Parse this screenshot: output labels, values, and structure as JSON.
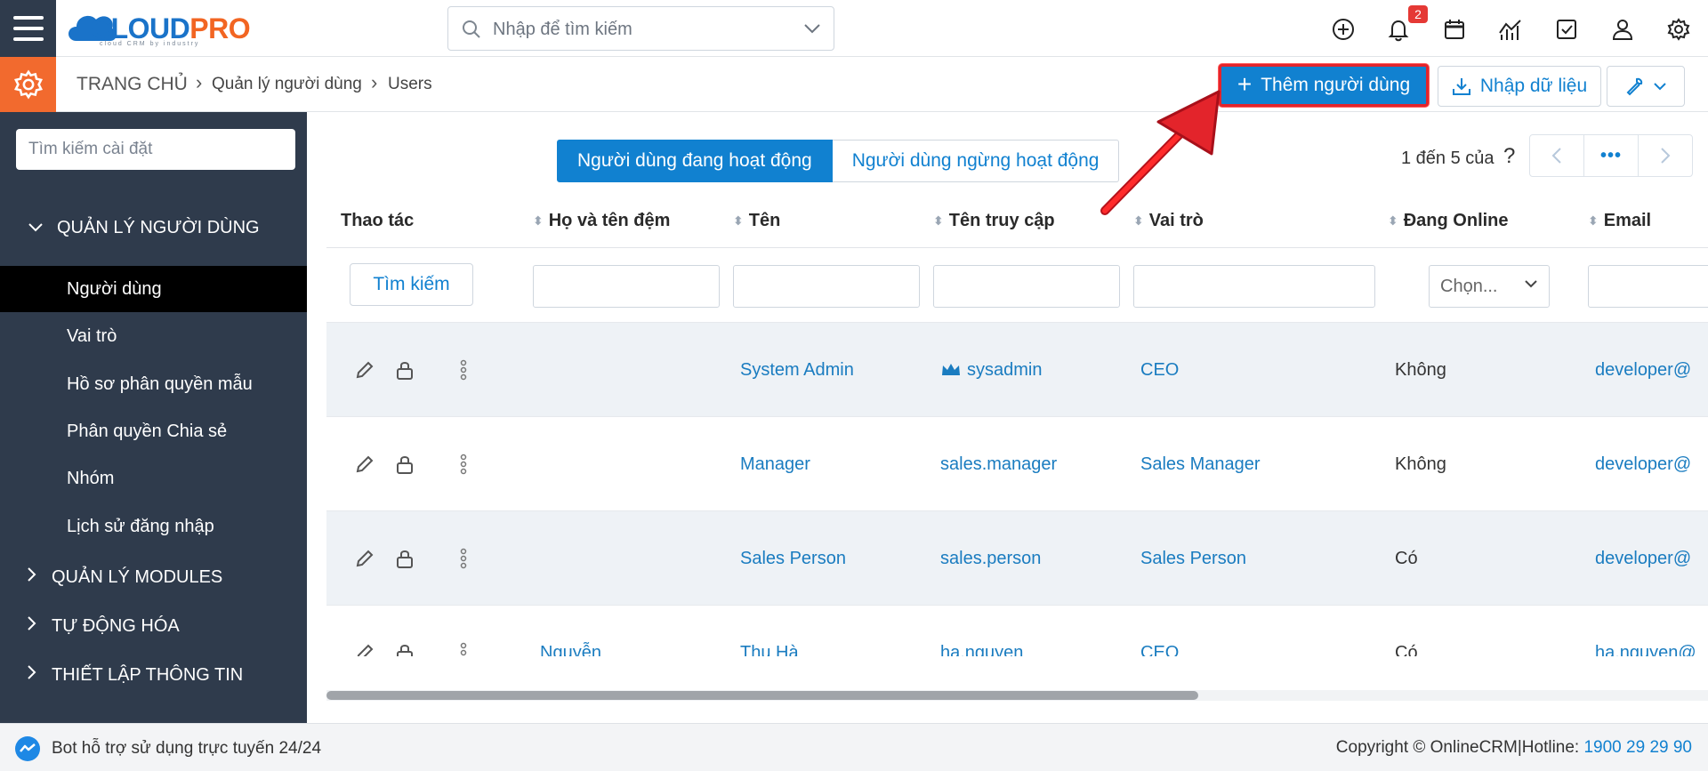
{
  "app": {
    "logo_main": "CLOUD",
    "logo_accent": "PRO",
    "logo_tagline": "cloud CRM by industry",
    "search_placeholder": "Nhập để tìm kiếm",
    "notification_count": "2"
  },
  "breadcrumb": {
    "home": "TRANG CHỦ",
    "section": "Quản lý người dùng",
    "page": "Users"
  },
  "toolbar": {
    "add_label": "Thêm người dùng",
    "import_label": "Nhập dữ liệu"
  },
  "sidebar": {
    "search_placeholder": "Tìm kiếm cài đặt",
    "group_users": "QUẢN LÝ NGƯỜI DÙNG",
    "items": [
      {
        "label": "Người dùng"
      },
      {
        "label": "Vai trò"
      },
      {
        "label": "Hồ sơ phân quyền mẫu"
      },
      {
        "label": "Phân quyền Chia sẻ"
      },
      {
        "label": "Nhóm"
      },
      {
        "label": "Lịch sử đăng nhập"
      }
    ],
    "group_modules": "QUẢN LÝ MODULES",
    "group_automation": "TỰ ĐỘNG HÓA",
    "group_info": "THIẾT LẬP THÔNG TIN"
  },
  "tabs": {
    "active": "Người dùng đang hoạt động",
    "inactive": "Người dùng ngừng hoạt động"
  },
  "pager": {
    "text": "1 đến 5 của",
    "help": "?",
    "more": "•••"
  },
  "table": {
    "headers": {
      "actions": "Thao tác",
      "last_name": "Họ và tên đệm",
      "first_name": "Tên",
      "username": "Tên truy cập",
      "role": "Vai trò",
      "online": "Đang Online",
      "email": "Email"
    },
    "filter_button": "Tìm kiếm",
    "filter_select": "Chọn...",
    "rows": [
      {
        "last_name": "",
        "first_name": "System Admin",
        "username": "sysadmin",
        "role": "CEO",
        "online": "Không",
        "email": "developer@"
      },
      {
        "last_name": "",
        "first_name": "Manager",
        "username": "sales.manager",
        "role": "Sales Manager",
        "online": "Không",
        "email": "developer@"
      },
      {
        "last_name": "",
        "first_name": "Sales Person",
        "username": "sales.person",
        "role": "Sales Person",
        "online": "Có",
        "email": "developer@"
      },
      {
        "last_name": "Nguyễn",
        "first_name": "Thu Hà",
        "username": "ha.nguyen",
        "role": "CEO",
        "online": "Có",
        "email": "ha.nguyen@"
      }
    ]
  },
  "footer": {
    "bot_text": "Bot hỗ trợ sử dụng trực tuyến 24/24",
    "copyright": "Copyright © OnlineCRM|Hotline: ",
    "hotline": "1900 29 29 90"
  },
  "colors": {
    "primary": "#1181d0",
    "sidebar": "#2f3b4c",
    "accent_orange": "#f26a2e",
    "highlight_red": "#e3242b"
  }
}
